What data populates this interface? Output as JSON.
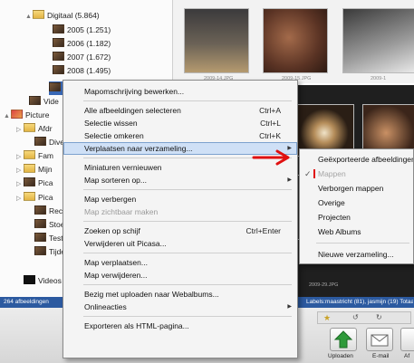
{
  "tree": {
    "items": [
      {
        "label": "Digitaal (5.864)",
        "icon": "folder-icon"
      },
      {
        "label": "2005 (1.251)",
        "icon": "thumbnail-icon"
      },
      {
        "label": "2006 (1.182)",
        "icon": "thumbnail-icon"
      },
      {
        "label": "2007 (1.672)",
        "icon": "thumbnail-icon"
      },
      {
        "label": "2008 (1.495)",
        "icon": "thumbnail-icon"
      },
      {
        "label": "",
        "icon": "thumbnail-icon"
      },
      {
        "label": "Vide",
        "icon": "thumbnail-icon"
      },
      {
        "label": "Picture",
        "icon": "pictures-icon"
      },
      {
        "label": "Afdr",
        "icon": "folder-icon"
      },
      {
        "label": "Dive",
        "icon": "thumbnail-icon"
      },
      {
        "label": "Fam",
        "icon": "folder-icon"
      },
      {
        "label": "Mijn",
        "icon": "folder-icon"
      },
      {
        "label": "Pica",
        "icon": "thumbnail-icon"
      },
      {
        "label": "Pica",
        "icon": "folder-icon"
      },
      {
        "label": "Reci",
        "icon": "thumbnail-icon"
      },
      {
        "label": "Stoe",
        "icon": "thumbnail-icon"
      },
      {
        "label": "Test",
        "icon": "thumbnail-icon"
      },
      {
        "label": "Tijde",
        "icon": "thumbnail-icon"
      },
      {
        "label": "Videos",
        "icon": "black-folder-icon"
      }
    ]
  },
  "topstrip": {
    "captions": [
      "2009-14.JPG",
      "2009-15.JPG",
      "2009-1"
    ]
  },
  "darkband": {
    "caption": "2009-29.JPG"
  },
  "statusbar": {
    "left": "264 afbeeldingen",
    "right": "Labels:maastricht (81), jasmijn (19) Totaal"
  },
  "bottombar": {
    "upload_label": "Uploaden",
    "email_label": "E-mail",
    "more_label": "Af"
  },
  "menu": {
    "items": [
      {
        "label": "Mapomschrijving bewerken...",
        "shortcut": "",
        "arrow": false,
        "disabled": false,
        "highlight": false
      },
      {
        "sep": true
      },
      {
        "label": "Alle afbeeldingen selecteren",
        "shortcut": "Ctrl+A",
        "arrow": false,
        "disabled": false,
        "highlight": false
      },
      {
        "label": "Selectie wissen",
        "shortcut": "Ctrl+L",
        "arrow": false,
        "disabled": false,
        "highlight": false
      },
      {
        "label": "Selectie omkeren",
        "shortcut": "Ctrl+K",
        "arrow": false,
        "disabled": false,
        "highlight": false
      },
      {
        "label": "Verplaatsen naar verzameling...",
        "shortcut": "",
        "arrow": true,
        "disabled": false,
        "highlight": true
      },
      {
        "sep": true
      },
      {
        "label": "Miniaturen vernieuwen",
        "shortcut": "",
        "arrow": false,
        "disabled": false,
        "highlight": false
      },
      {
        "label": "Map sorteren op...",
        "shortcut": "",
        "arrow": true,
        "disabled": false,
        "highlight": false
      },
      {
        "sep": true
      },
      {
        "label": "Map verbergen",
        "shortcut": "",
        "arrow": false,
        "disabled": false,
        "highlight": false
      },
      {
        "label": "Map zichtbaar maken",
        "shortcut": "",
        "arrow": false,
        "disabled": true,
        "highlight": false
      },
      {
        "sep": true
      },
      {
        "label": "Zoeken op schijf",
        "shortcut": "Ctrl+Enter",
        "arrow": false,
        "disabled": false,
        "highlight": false
      },
      {
        "label": "Verwijderen uit Picasa...",
        "shortcut": "",
        "arrow": false,
        "disabled": false,
        "highlight": false
      },
      {
        "sep": true
      },
      {
        "label": "Map verplaatsen...",
        "shortcut": "",
        "arrow": false,
        "disabled": false,
        "highlight": false
      },
      {
        "label": "Map verwijderen...",
        "shortcut": "",
        "arrow": false,
        "disabled": false,
        "highlight": false
      },
      {
        "sep": true
      },
      {
        "label": "Bezig met uploaden naar Webalbums...",
        "shortcut": "",
        "arrow": false,
        "disabled": false,
        "highlight": false
      },
      {
        "label": "Onlineacties",
        "shortcut": "",
        "arrow": true,
        "disabled": false,
        "highlight": false
      },
      {
        "sep": true
      },
      {
        "label": "Exporteren als HTML-pagina...",
        "shortcut": "",
        "arrow": false,
        "disabled": false,
        "highlight": false
      }
    ]
  },
  "submenu": {
    "items": [
      {
        "label": "Geëxporteerde afbeeldingen",
        "checked": false,
        "disabled": false
      },
      {
        "label": "Mappen",
        "checked": true,
        "disabled": true
      },
      {
        "label": "Verborgen mappen",
        "checked": false,
        "disabled": false
      },
      {
        "label": "Overige",
        "checked": false,
        "disabled": false
      },
      {
        "label": "Projecten",
        "checked": false,
        "disabled": false
      },
      {
        "label": "Web Albums",
        "checked": false,
        "disabled": false
      },
      {
        "sep": true
      },
      {
        "label": "Nieuwe verzameling...",
        "checked": false,
        "disabled": false
      }
    ]
  },
  "colors": {
    "accent_arrow": "#e01010",
    "highlight": "#cfe0f6",
    "statusbar": "#2c5aa0"
  }
}
